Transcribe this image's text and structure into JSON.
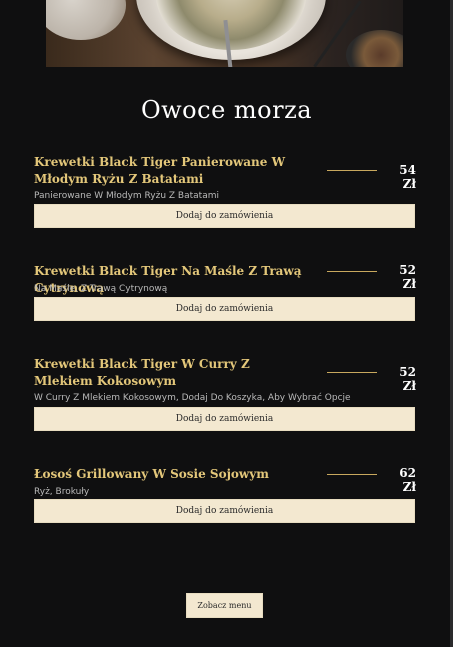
{
  "hero": {
    "image_alt": "food-plate-photo"
  },
  "section": {
    "title": "Owoce morza"
  },
  "items": [
    {
      "name": "Krewetki Black Tiger Panierowane W Młodym Ryżu Z Batatami",
      "price": "54 Zł",
      "description": "Panierowane W Młodym Ryżu Z Batatami",
      "button": "Dodaj do zamówienia"
    },
    {
      "name": "Krewetki Black Tiger Na Maśle Z Trawą Cytrynową",
      "price": "52 Zł",
      "description": "Na Maśle, Z Trawą Cytrynową",
      "button": "Dodaj do zamówienia"
    },
    {
      "name": "Krewetki Black Tiger W Curry Z Mlekiem Kokosowym",
      "price": "52 Zł",
      "description": "W Curry Z Mlekiem Kokosowym, Dodaj Do Koszyka, Aby Wybrać Opcje",
      "button": "Dodaj do zamówienia"
    },
    {
      "name": "Łosoś Grillowany W Sosie Sojowym",
      "price": "62 Zł",
      "description": "Ryż, Brokuły",
      "button": "Dodaj do zamówienia"
    }
  ],
  "footer": {
    "menu_button": "Zobacz menu"
  },
  "colors": {
    "background": "#0f0f10",
    "item_name": "#e3c77a",
    "button_bg": "#f3e8d0",
    "price": "#ffffff"
  }
}
